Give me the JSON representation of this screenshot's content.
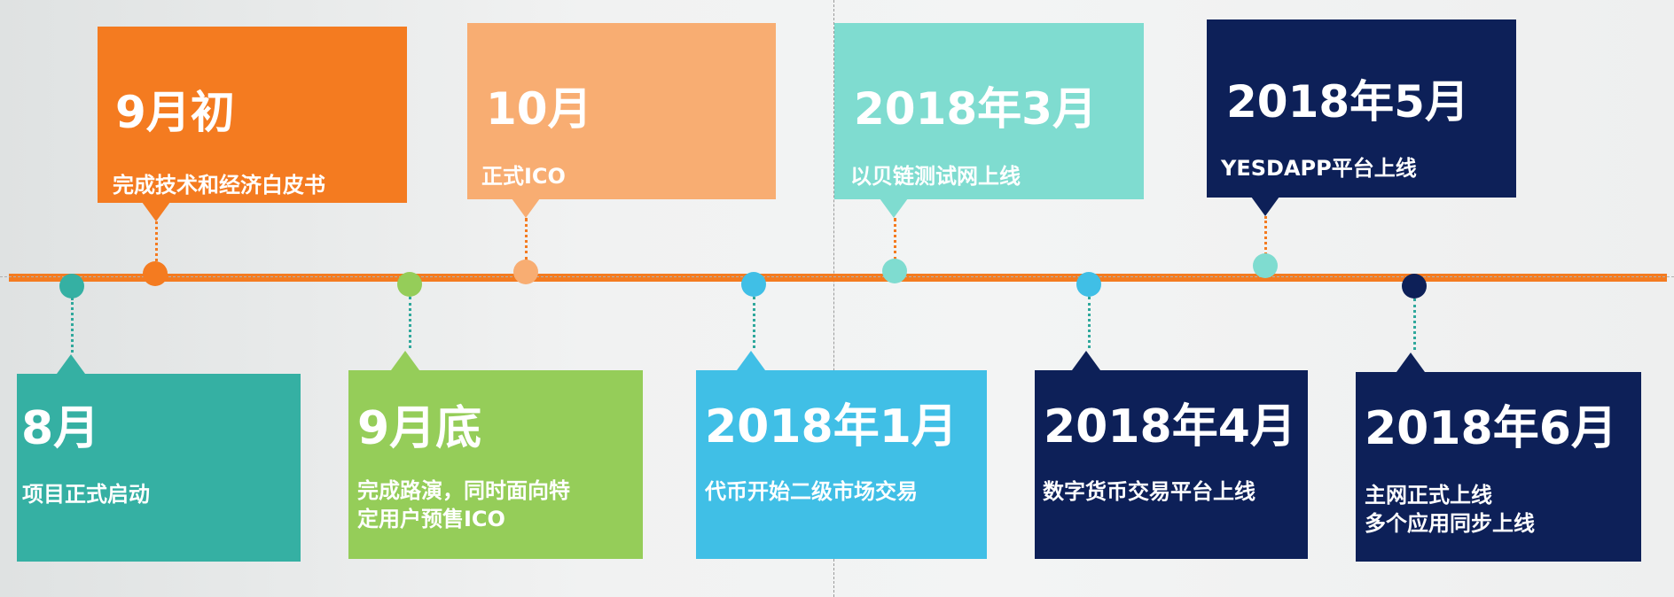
{
  "colors": {
    "axis": "#f47b20",
    "orange": "#f47b20",
    "light_orange": "#f8ad72",
    "teal": "#35b0a3",
    "mint": "#7fdcd0",
    "green": "#95cd59",
    "sky_blue": "#40bfe6",
    "navy": "#0d2058",
    "stem_orange": "#f47b20",
    "stem_teal": "#2fa89c"
  },
  "milestones_top": [
    {
      "date": "9月初",
      "desc": [
        "完成技术和经济白皮书"
      ]
    },
    {
      "date": "10月",
      "desc": [
        "正式ICO"
      ]
    },
    {
      "date": "2018年3月",
      "desc": [
        "以贝链测试网上线"
      ]
    },
    {
      "date": "2018年5月",
      "desc": [
        "YESDAPP平台上线"
      ]
    }
  ],
  "milestones_bottom": [
    {
      "date": "8月",
      "desc": [
        "项目正式启动"
      ]
    },
    {
      "date": "9月底",
      "desc": [
        "完成路演，同时面向特",
        "定用户预售ICO"
      ]
    },
    {
      "date": "2018年1月",
      "desc": [
        "代币开始二级市场交易"
      ]
    },
    {
      "date": "2018年4月",
      "desc": [
        "数字货币交易平台上线"
      ]
    },
    {
      "date": "2018年6月",
      "desc": [
        "主网正式上线",
        "多个应用同步上线"
      ]
    }
  ]
}
